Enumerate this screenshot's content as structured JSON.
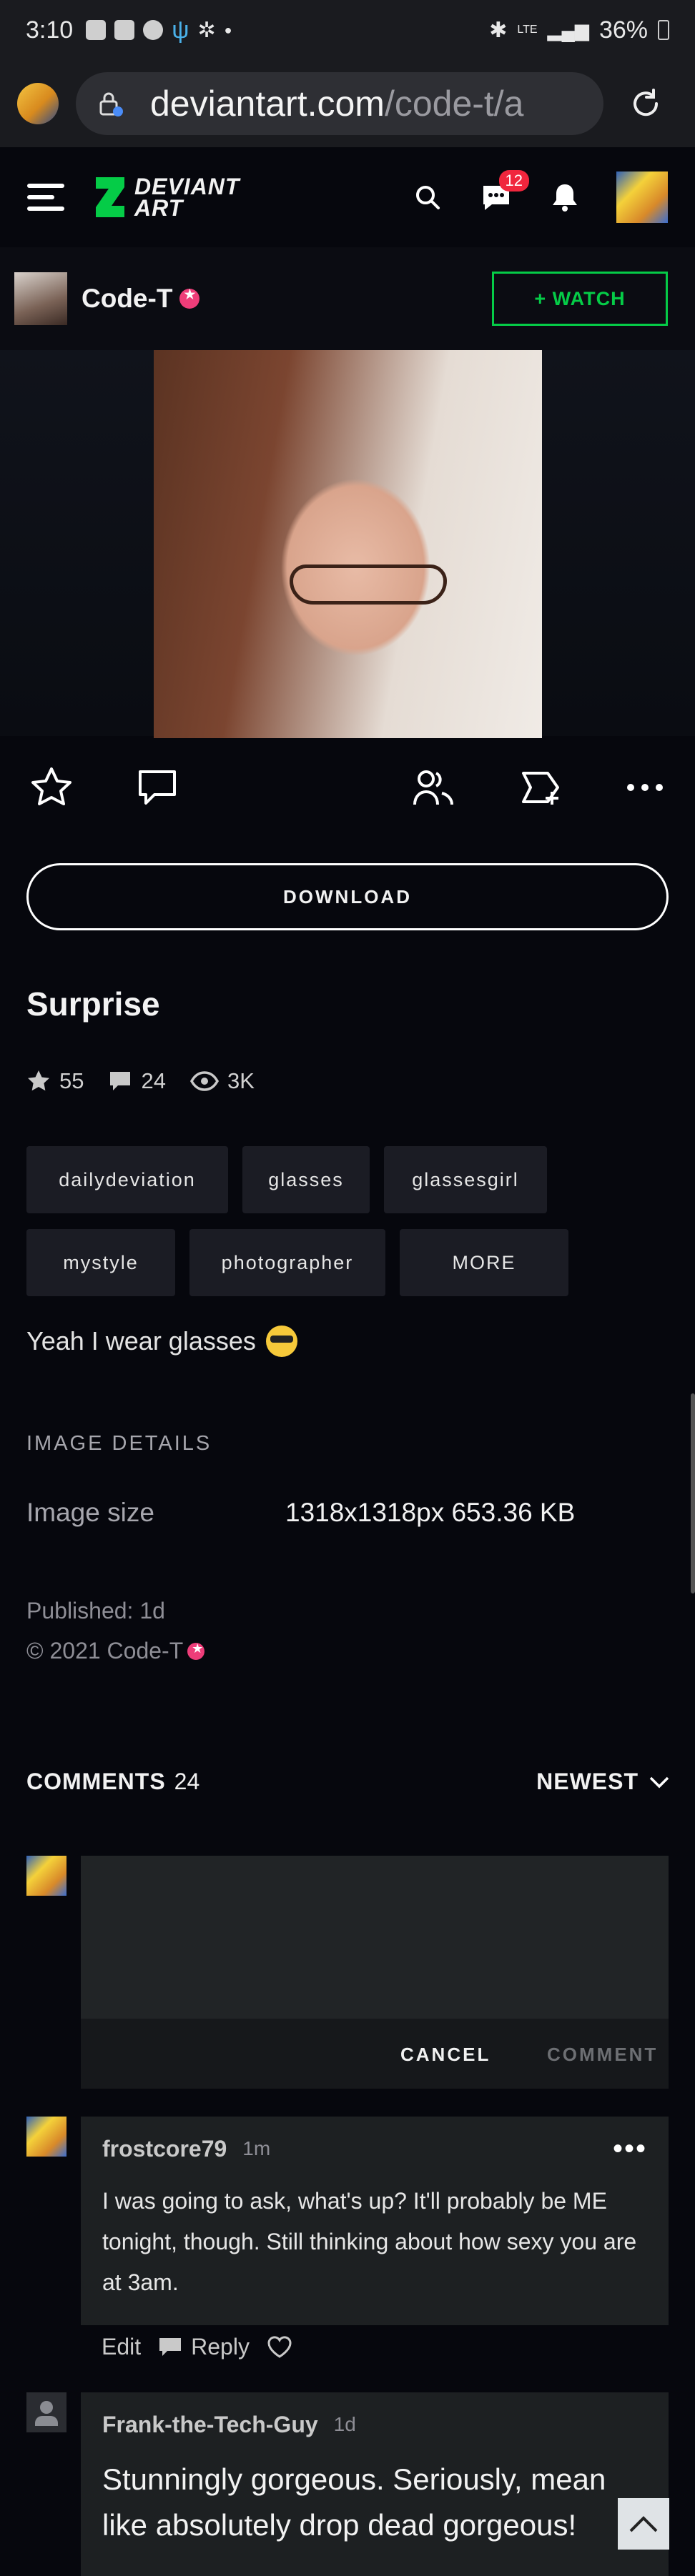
{
  "status_bar": {
    "time": "3:10",
    "battery": "36%",
    "network": "LTE"
  },
  "browser": {
    "url_domain": "deviantart.com",
    "url_path": "/code-t/a"
  },
  "header": {
    "logo_line1": "DEVIANT",
    "logo_line2": "ART",
    "notifications_count": "12"
  },
  "author": {
    "name": "Code-T",
    "watch_label": "+ WATCH"
  },
  "deviation": {
    "download_label": "DOWNLOAD",
    "title": "Surprise",
    "stats": {
      "favourites": "55",
      "comments": "24",
      "views": "3K"
    },
    "tags": [
      "dailydeviation",
      "glasses",
      "glassesgirl",
      "mystyle",
      "photographer"
    ],
    "more_label": "MORE",
    "description": "Yeah I wear glasses"
  },
  "details": {
    "section_label": "IMAGE DETAILS",
    "image_size_label": "Image size",
    "image_size_value": "1318x1318px 653.36 KB",
    "published": "Published: 1d",
    "copyright": "© 2021 Code-T"
  },
  "comments": {
    "label": "COMMENTS",
    "count": "24",
    "sort": "NEWEST",
    "cancel_label": "CANCEL",
    "comment_label": "COMMENT",
    "items": [
      {
        "user": "frostcore79",
        "time": "1m",
        "text": "I was going to ask, what's up? It'll probably be ME tonight, though. Still thinking about how sexy you are at 3am.",
        "edit_label": "Edit",
        "reply_label": "Reply"
      },
      {
        "user": "Frank-the-Tech-Guy",
        "time": "1d",
        "text": "Stunningly gorgeous. Seriously, mean like absolutely drop dead gorgeous!"
      }
    ]
  },
  "colors": {
    "accent_green": "#05cc47",
    "badge_red": "#f0263d",
    "core_pink": "#ee3d79",
    "background": "#06070d"
  }
}
